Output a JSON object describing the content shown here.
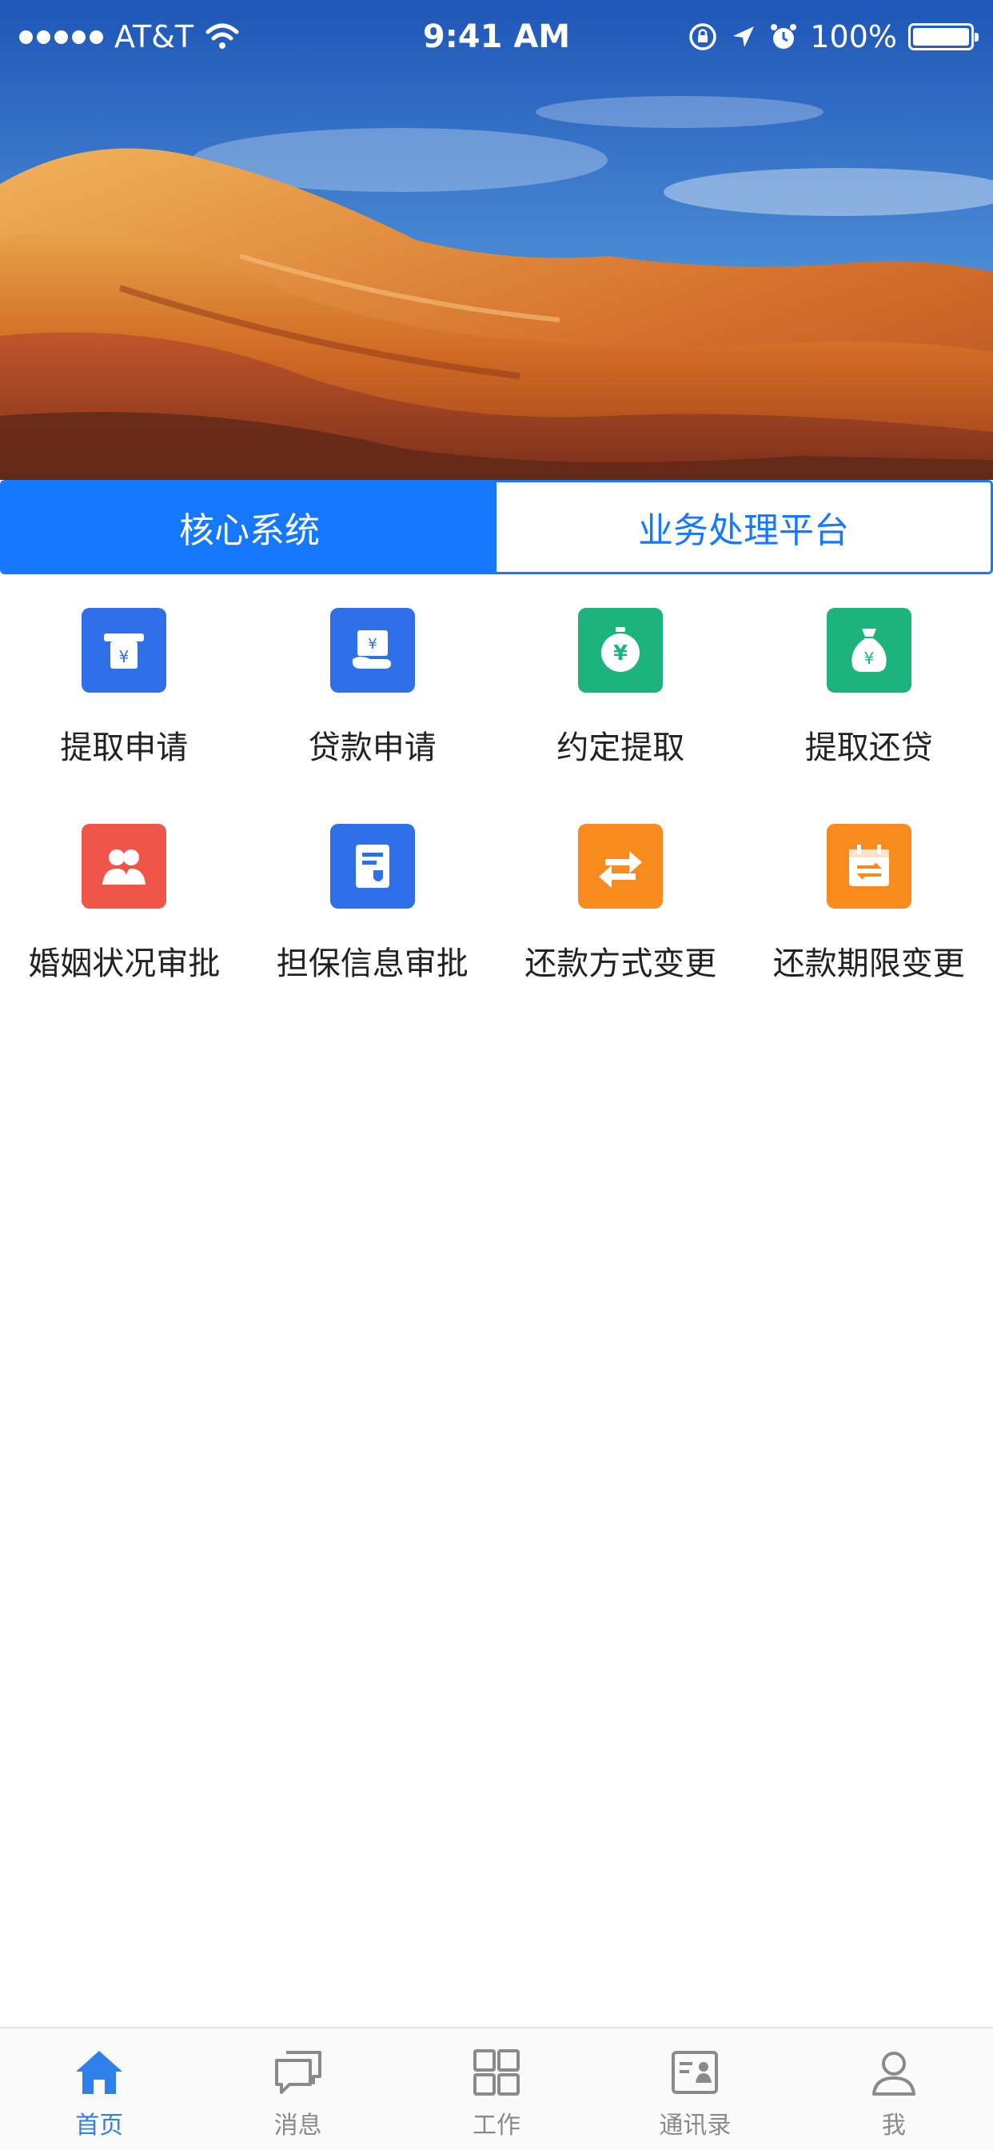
{
  "status_bar": {
    "carrier": "AT&T",
    "time": "9:41 AM",
    "battery": "100%"
  },
  "tabs": [
    {
      "label": "核心系统",
      "active": true
    },
    {
      "label": "业务处理平台",
      "active": false
    }
  ],
  "grid": [
    {
      "label": "提取申请",
      "icon": "atm-yuan-icon",
      "color": "#2f6fe8"
    },
    {
      "label": "贷款申请",
      "icon": "hand-yuan-icon",
      "color": "#2f6fe8"
    },
    {
      "label": "约定提取",
      "icon": "money-timer-icon",
      "color": "#1db37c"
    },
    {
      "label": "提取还贷",
      "icon": "money-bag-icon",
      "color": "#1db37c"
    },
    {
      "label": "婚姻状况审批",
      "icon": "couple-icon",
      "color": "#f0554a"
    },
    {
      "label": "担保信息审批",
      "icon": "guarantee-doc-icon",
      "color": "#2f6fe8"
    },
    {
      "label": "还款方式变更",
      "icon": "swap-arrows-icon",
      "color": "#f98a1e"
    },
    {
      "label": "还款期限变更",
      "icon": "calendar-swap-icon",
      "color": "#f98a1e"
    }
  ],
  "bottom_nav": [
    {
      "label": "首页",
      "icon": "home-icon",
      "active": true
    },
    {
      "label": "消息",
      "icon": "chat-icon",
      "active": false
    },
    {
      "label": "工作",
      "icon": "grid-icon",
      "active": false
    },
    {
      "label": "通讯录",
      "icon": "contacts-icon",
      "active": false
    },
    {
      "label": "我",
      "icon": "person-icon",
      "active": false
    }
  ],
  "colors": {
    "accent": "#1677ff",
    "nav_active": "#2f80e8",
    "nav_inactive": "#8a8a8a"
  }
}
